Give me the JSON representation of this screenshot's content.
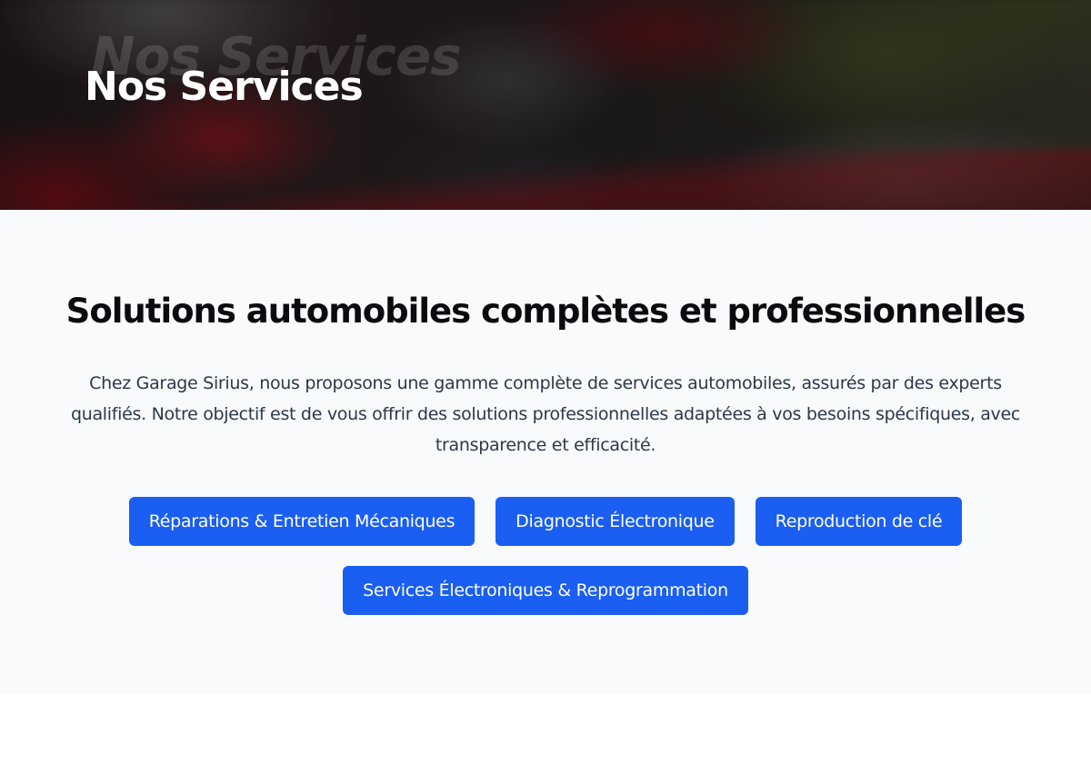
{
  "hero": {
    "title": "Nos Services"
  },
  "services": {
    "heading": "Solutions automobiles complètes et professionnelles",
    "intro": "Chez Garage Sirius, nous proposons une gamme complète de services automobiles, assurés par des experts qualifiés. Notre objectif est de vous offrir des solutions professionnelles adaptées à vos besoins spécifiques, avec transparence et efficacité.",
    "buttons": [
      {
        "label": "Réparations & Entretien Mécaniques"
      },
      {
        "label": "Diagnostic Électronique"
      },
      {
        "label": "Reproduction de clé"
      },
      {
        "label": "Services Électroniques & Reprogrammation"
      }
    ]
  },
  "colors": {
    "accent": "#1a5ef2",
    "section_bg": "#f8fafc",
    "heading_text": "#0b0b0f",
    "body_text": "#2d3748"
  }
}
